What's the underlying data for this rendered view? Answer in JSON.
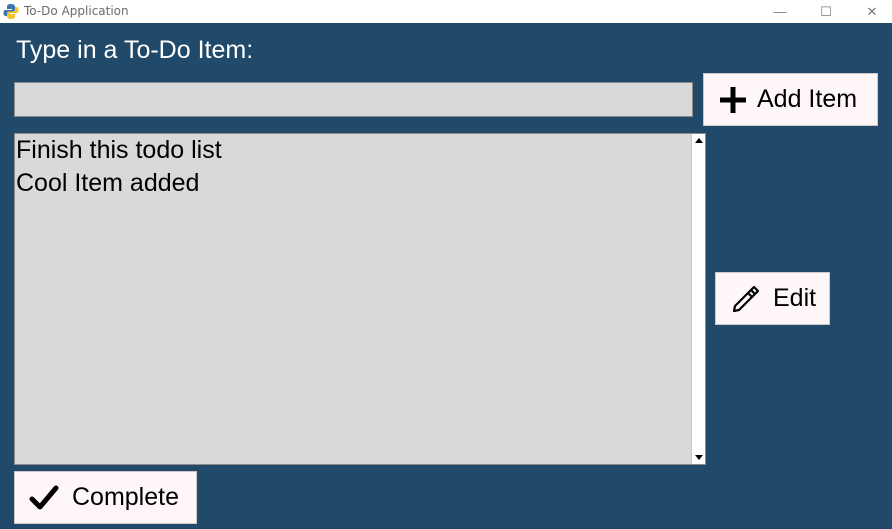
{
  "window": {
    "title": "To-Do Application",
    "controls": {
      "minimize": "—",
      "maximize": "☐",
      "close": "✕"
    }
  },
  "colors": {
    "background": "#214a6a",
    "field": "#d9d9d9",
    "button": "#fff7f7",
    "label_text": "#ffffff"
  },
  "form": {
    "prompt_label": "Type in a To-Do Item:",
    "input_value": ""
  },
  "buttons": {
    "add": {
      "label": "Add Item",
      "icon": "plus-icon"
    },
    "edit": {
      "label": "Edit",
      "icon": "pencil-icon"
    },
    "complete": {
      "label": "Complete",
      "icon": "checkmark-icon"
    }
  },
  "todo_list": {
    "items": [
      "Finish this todo list",
      "Cool Item added"
    ]
  }
}
